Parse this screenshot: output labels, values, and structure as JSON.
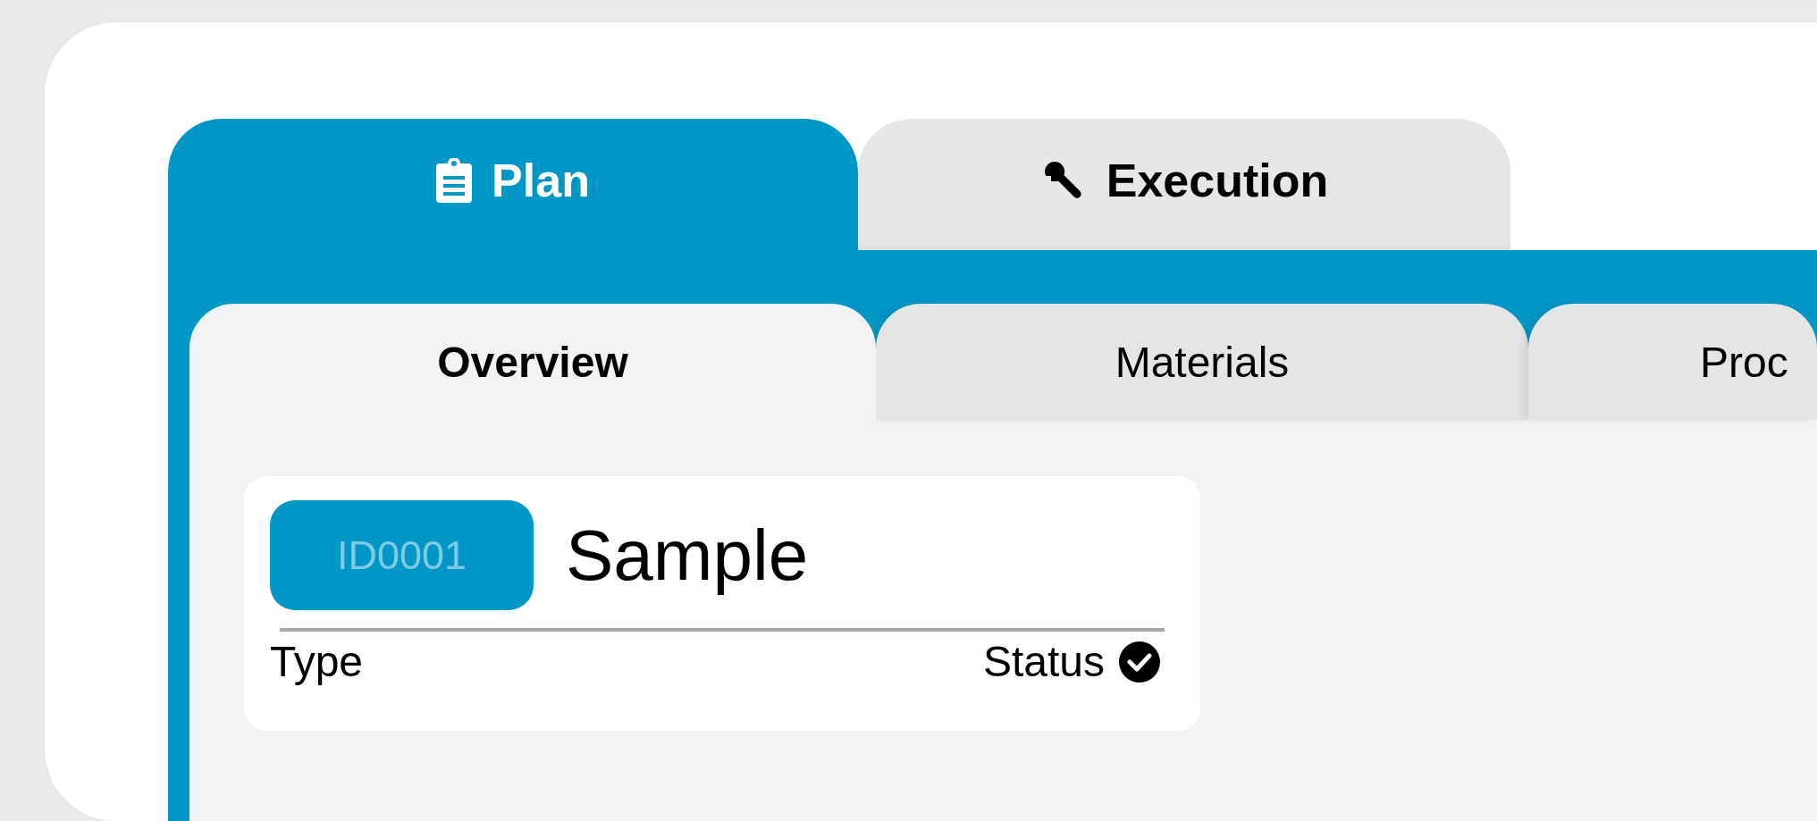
{
  "main_tabs": [
    {
      "label": "Plan",
      "selected": true
    },
    {
      "label": "Execution",
      "selected": false
    }
  ],
  "sub_tabs": [
    {
      "label": "Overview",
      "selected": true
    },
    {
      "label": "Materials",
      "selected": false
    },
    {
      "label": "Proc",
      "selected": false
    }
  ],
  "record": {
    "id": "ID0001",
    "name": "Sample",
    "type": "Type",
    "status": "Status",
    "complete": true
  }
}
